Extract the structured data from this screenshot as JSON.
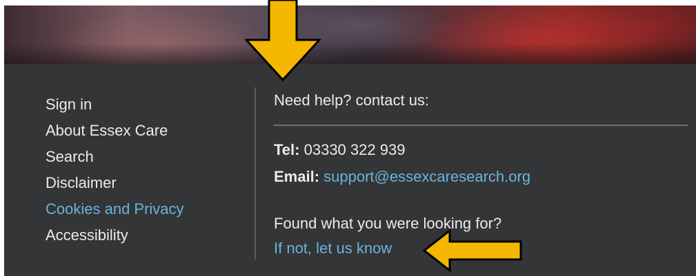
{
  "footer": {
    "nav_links": [
      {
        "label": "Sign in"
      },
      {
        "label": "About Essex Care"
      },
      {
        "label": "Search"
      },
      {
        "label": "Disclaimer"
      },
      {
        "label": "Cookies and Privacy"
      },
      {
        "label": "Accessibility"
      }
    ],
    "help": {
      "title": "Need help? contact us:",
      "tel_label": "Tel:",
      "tel_value": "03330 322 939",
      "email_label": "Email:",
      "email_value": "support@essexcaresearch.org",
      "found_prompt": "Found what you were looking for?",
      "feedback_link": "If not, let us know"
    }
  },
  "annotations": {
    "arrow_color": "#F5B800",
    "arrow_outline": "#000000"
  },
  "colors": {
    "footer_bg": "#333537",
    "link_blue": "#6AB4DC",
    "text": "#EBEBEB"
  },
  "icons": [
    "down-arrow-annotation-icon",
    "left-arrow-annotation-icon"
  ]
}
